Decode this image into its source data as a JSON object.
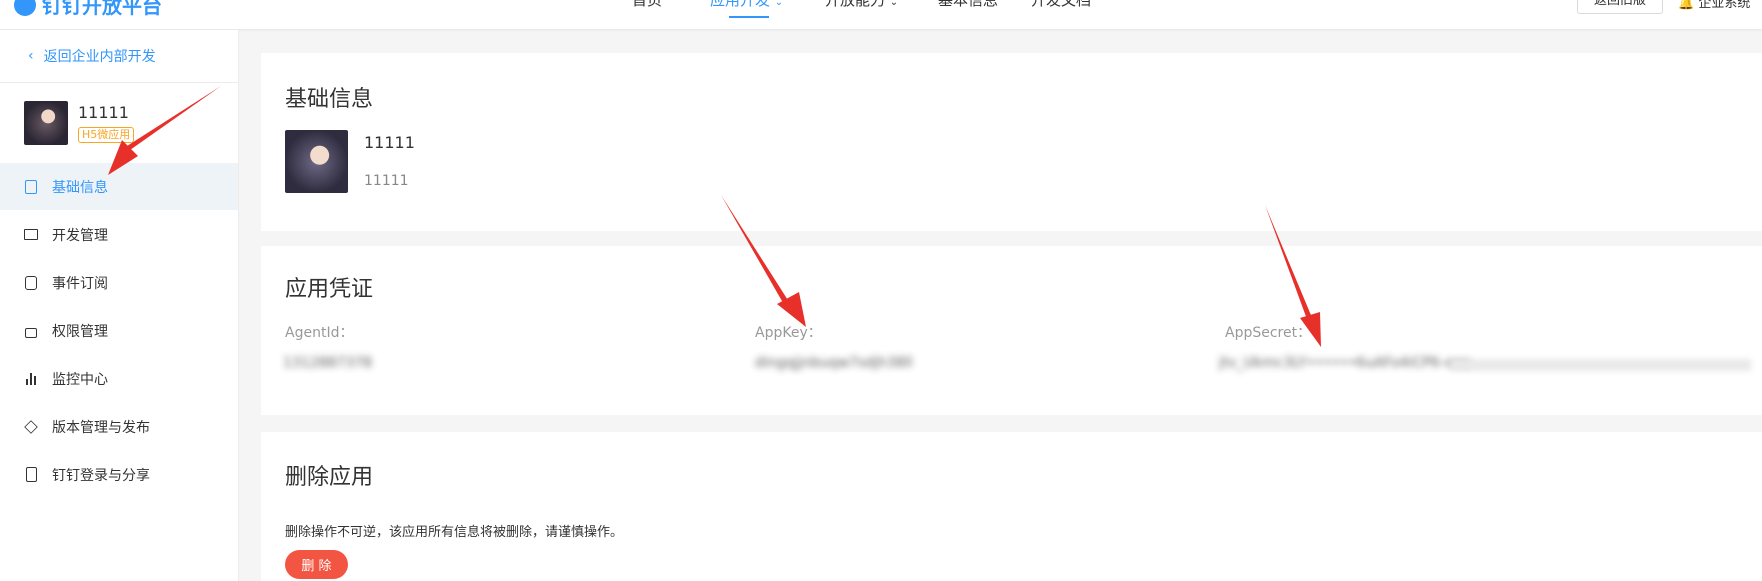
{
  "topbar": {
    "logo_text": "钉钉开放平台",
    "nav": [
      "首页",
      "应用开发",
      "开放能力",
      "基本信息",
      "开发文档"
    ],
    "button": "返回旧版",
    "user": "企业系统"
  },
  "sidebar": {
    "back_label": "返回企业内部开发",
    "app_name": "11111",
    "app_badge": "H5微应用",
    "items": [
      "基础信息",
      "开发管理",
      "事件订阅",
      "权限管理",
      "监控中心",
      "版本管理与发布",
      "钉钉登录与分享"
    ]
  },
  "basic_info": {
    "title": "基础信息",
    "app_name": "11111",
    "app_desc": "11111"
  },
  "credentials": {
    "title": "应用凭证",
    "agentid_label": "AgentId：",
    "agentid_value": "1312887378",
    "appkey_label": "AppKey：",
    "appkey_value": "dingqjjnbuqw7sdjh38ll",
    "appsecret_label": "AppSecret：",
    "appsecret_value": "jtv_Ukmc3LY••••••6uAFo4iCP6-ooo"
  },
  "delete": {
    "title": "删除应用",
    "description": "删除操作不可逆，该应用所有信息将被删除，请谨慎操作。",
    "button": "删 除"
  },
  "colors": {
    "brand": "#3296fa",
    "danger": "#f25643",
    "badge": "#f5a623",
    "annotation_arrow": "#e8302a"
  }
}
